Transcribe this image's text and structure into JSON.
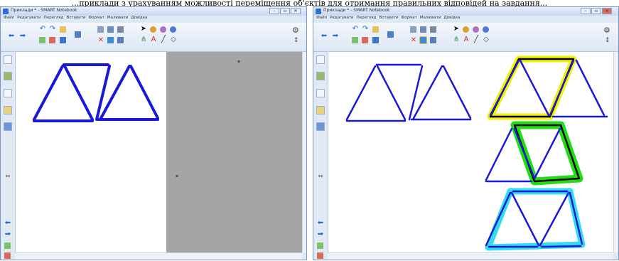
{
  "caption": "...приклади з урахуванням можливості переміщення об'єктів для отримання правильних відповідей на завдання...",
  "left_window": {
    "title": "Приклади * - SMART Notebook",
    "menu": [
      "Файл",
      "Редагувати",
      "Перегляд",
      "Вставити",
      "Формат",
      "Малювати",
      "Довідка"
    ]
  },
  "right_window": {
    "title": "Приклади * - SMART Notebook",
    "menu": [
      "Файл",
      "Редагувати",
      "Перегляд",
      "Вставити",
      "Формат",
      "Малювати",
      "Довідка"
    ]
  },
  "window_buttons": [
    "–",
    "▫",
    "✕"
  ],
  "toolbar_icons": [
    "back-arrow-icon",
    "forward-arrow-icon",
    "undo-icon",
    "redo-icon",
    "open-file-icon",
    "add-page-icon",
    "delete-page-icon",
    "save-icon",
    "screen-shade-icon",
    "table-icon",
    "gallery-icon",
    "capture-icon",
    "select-icon",
    "pen-icon",
    "eraser-icon",
    "fill-icon",
    "text-icon",
    "line-icon",
    "shape-icon",
    "settings-icon"
  ],
  "colors": {
    "matches": "#1a1ad6",
    "yellow": "#f2f200",
    "green": "#22dd11",
    "cyan": "#33ddee",
    "grey_area": "#a5a5a5"
  }
}
